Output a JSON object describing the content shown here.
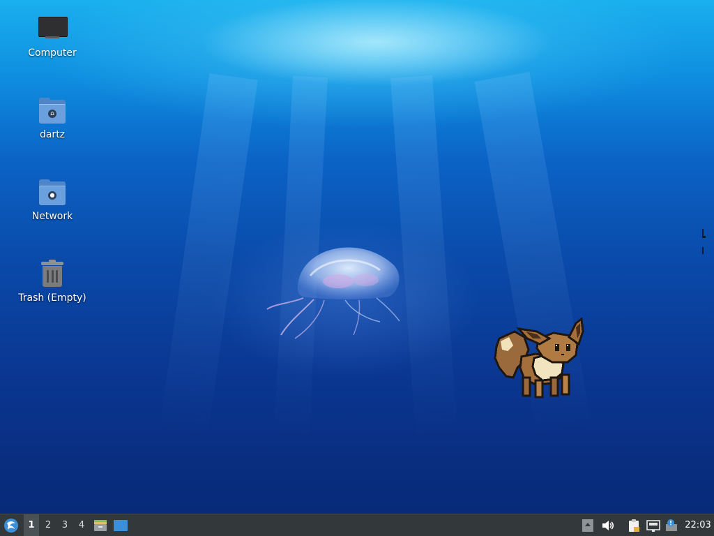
{
  "desktop": {
    "icons": [
      {
        "label": "Computer",
        "icon": "computer-icon"
      },
      {
        "label": "dartz",
        "icon": "home-folder-icon"
      },
      {
        "label": "Network",
        "icon": "network-folder-icon"
      },
      {
        "label": "Trash (Empty)",
        "icon": "trash-icon"
      }
    ],
    "wallpaper": {
      "subject": "jellyfish-underwater",
      "colors": {
        "surface": "#1ab0ee",
        "deep": "#082a78"
      }
    },
    "widget": {
      "name": "eevee-sprite"
    }
  },
  "taskbar": {
    "menu_icon": "app-menu-icon",
    "workspaces": [
      {
        "label": "1",
        "active": true
      },
      {
        "label": "2",
        "active": false
      },
      {
        "label": "3",
        "active": false
      },
      {
        "label": "4",
        "active": false
      }
    ],
    "launchers": [
      {
        "icon": "file-manager-icon"
      },
      {
        "icon": "show-desktop-icon"
      }
    ],
    "tray": [
      {
        "icon": "tray-expand-icon"
      },
      {
        "icon": "volume-icon"
      },
      {
        "icon": "clipboard-icon"
      },
      {
        "icon": "network-wired-icon"
      },
      {
        "icon": "update-notifier-icon"
      }
    ],
    "clock": "22:03",
    "colors": {
      "panel": "#33393b",
      "accent": "#3b8fd8"
    }
  }
}
